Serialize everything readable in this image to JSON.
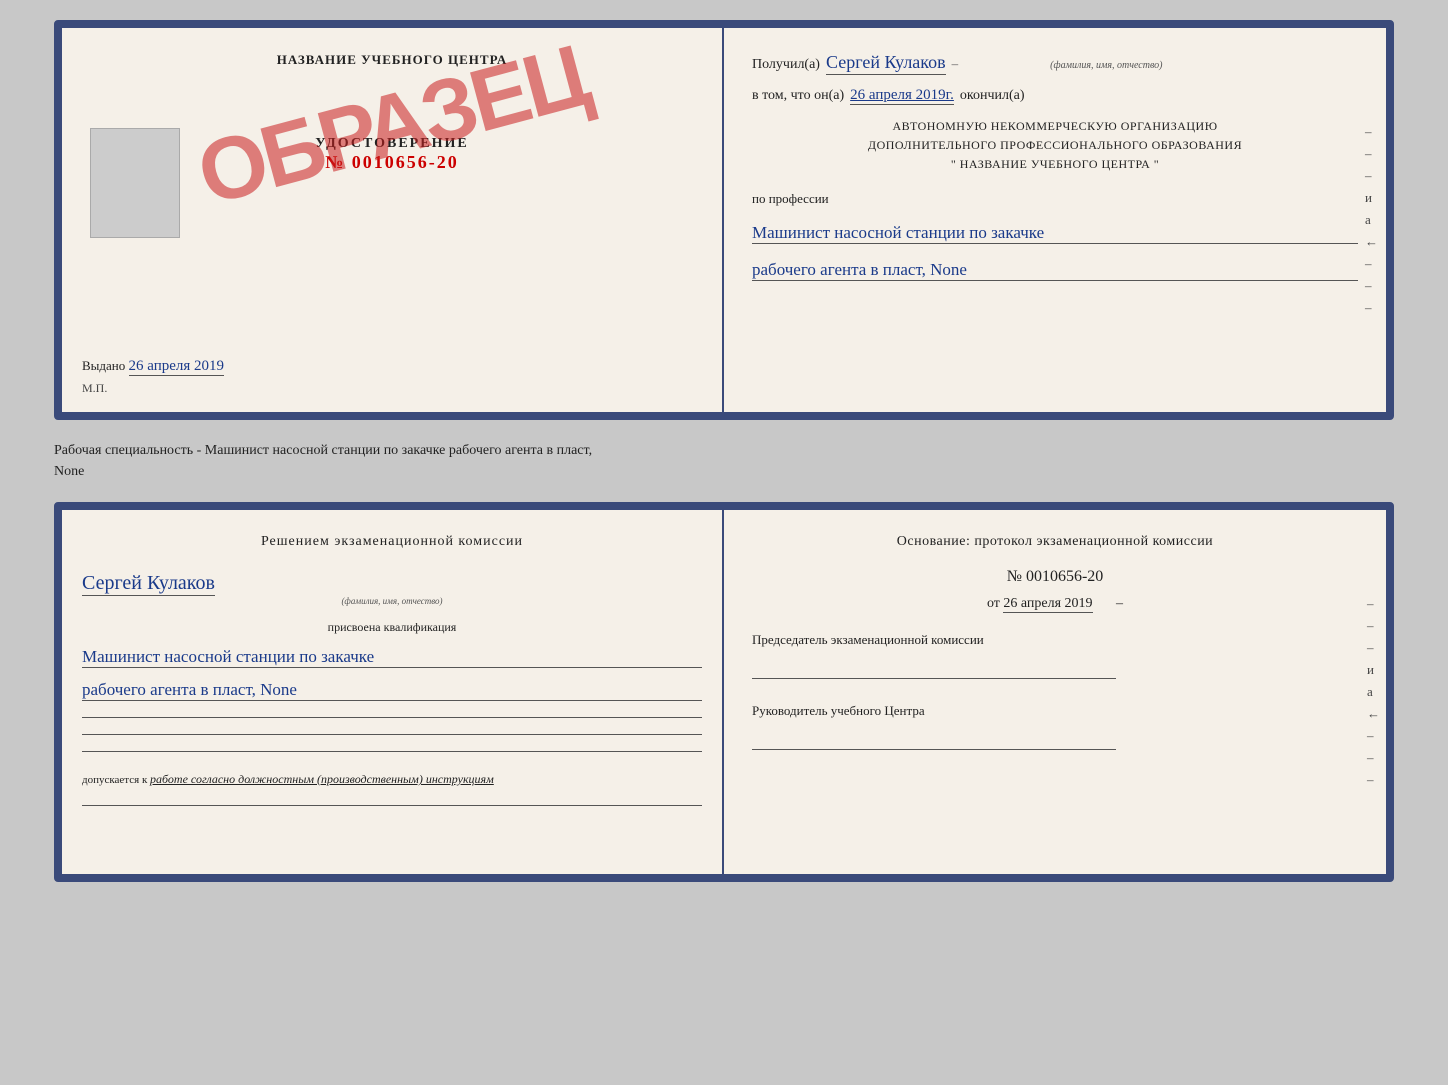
{
  "top_doc": {
    "left": {
      "title": "НАЗВАНИЕ УЧЕБНОГО ЦЕНТРА",
      "cert_label": "УДОСТОВЕРЕНИЕ",
      "cert_number": "№ 0010656-20",
      "stamp": "ОБРАЗЕЦ",
      "issued_label": "Выдано",
      "issued_date": "26 апреля 2019",
      "mp": "М.П."
    },
    "right": {
      "recipient_prefix": "Получил(а)",
      "recipient_name": "Сергей Кулаков",
      "recipient_hint": "(фамилия, имя, отчество)",
      "date_prefix": "в том, что он(а)",
      "date_value": "26 апреля 2019г.",
      "date_suffix": "окончил(а)",
      "org_line1": "АВТОНОМНУЮ НЕКОММЕРЧЕСКУЮ ОРГАНИЗАЦИЮ",
      "org_line2": "ДОПОЛНИТЕЛЬНОГО ПРОФЕССИОНАЛЬНОГО ОБРАЗОВАНИЯ",
      "org_line3": "\"   НАЗВАНИЕ УЧЕБНОГО ЦЕНТРА   \"",
      "profession_label": "по профессии",
      "profession_line1": "Машинист насосной станции по закачке",
      "profession_line2": "рабочего агента в пласт, None",
      "dashes": [
        "–",
        "–",
        "–",
        "и",
        "а",
        "←",
        "–",
        "–",
        "–"
      ]
    }
  },
  "separator": {
    "text_line1": "Рабочая специальность - Машинист насосной станции по закачке рабочего агента в пласт,",
    "text_line2": "None"
  },
  "bottom_doc": {
    "left": {
      "decision_title": "Решением экзаменационной комиссии",
      "person_name": "Сергей Кулаков",
      "person_hint": "(фамилия, имя, отчество)",
      "qualification_label": "присвоена квалификация",
      "qualification_line1": "Машинист насосной станции по закачке",
      "qualification_line2": "рабочего агента в пласт, None",
      "допускается_prefix": "допускается к",
      "допускается_value": "работе согласно должностным (производственным) инструкциям"
    },
    "right": {
      "osnov_title": "Основание: протокол экзаменационной комиссии",
      "protocol_number": "№ 0010656-20",
      "protocol_date_prefix": "от",
      "protocol_date": "26 апреля 2019",
      "chairman_label": "Председатель экзаменационной комиссии",
      "rukovoditel_label": "Руководитель учебного Центра",
      "dashes": [
        "–",
        "–",
        "–",
        "и",
        "а",
        "←",
        "–",
        "–",
        "–"
      ]
    }
  }
}
